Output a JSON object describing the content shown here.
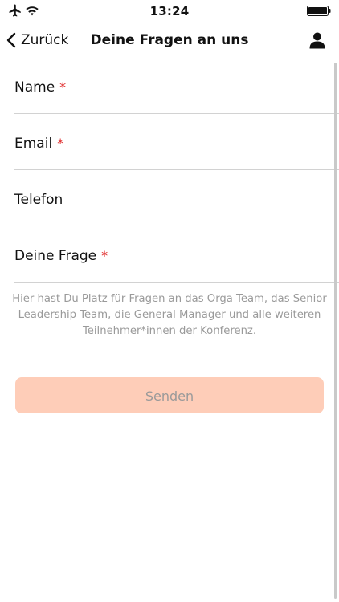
{
  "status_bar": {
    "time": "13:24",
    "icons": [
      "airplane-icon",
      "wifi-icon",
      "battery-icon"
    ]
  },
  "nav": {
    "back_label": "Zurück",
    "title": "Deine Fragen an uns",
    "profile_icon": "person-icon"
  },
  "form": {
    "fields": [
      {
        "label": "Name",
        "required": "*",
        "value": ""
      },
      {
        "label": "Email",
        "required": "*",
        "value": ""
      },
      {
        "label": "Telefon",
        "required": "",
        "value": ""
      },
      {
        "label": "Deine Frage",
        "required": "*",
        "value": ""
      }
    ],
    "hint": "Hier hast Du Platz für Fragen an das Orga Team, das Senior Leadership Team, die General Manager und alle weiteren Teilnehmer*innen der Konferenz.",
    "submit_label": "Senden"
  },
  "colors": {
    "required": "#e02b2b",
    "button_bg": "#fecdb8",
    "hint_text": "#9a9a9a",
    "divider": "#d2d2d2"
  }
}
